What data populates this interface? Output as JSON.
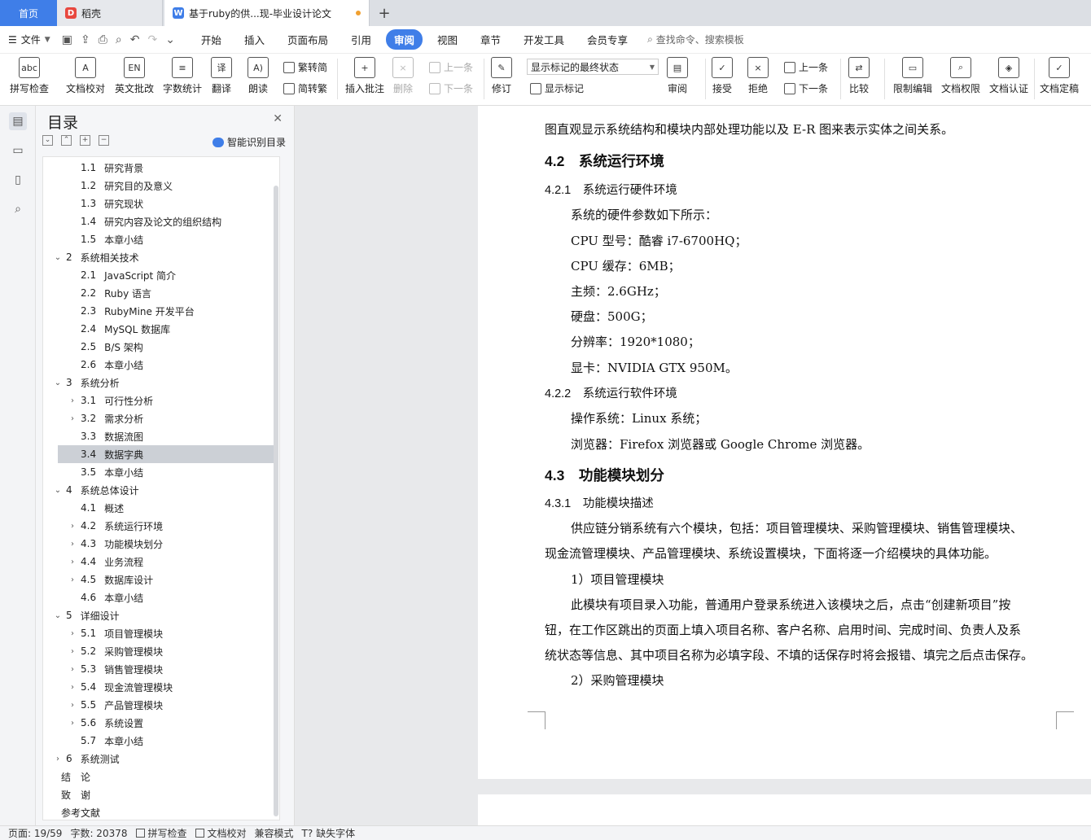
{
  "tabs": {
    "home": "首页",
    "daoke": "稻壳",
    "doc": "基于ruby的供...现-毕业设计论文",
    "add": "+"
  },
  "menubar": {
    "file": "文件",
    "items": [
      "开始",
      "插入",
      "页面布局",
      "引用",
      "审阅",
      "视图",
      "章节",
      "开发工具",
      "会员专享"
    ],
    "active": "审阅",
    "search_placeholder": "查找命令、搜索模板"
  },
  "ribbon": {
    "spell": "拼写检查",
    "doc_check": "文档校对",
    "en_correct": "英文批改",
    "word_count": "字数统计",
    "translate": "翻译",
    "read": "朗读",
    "to_trad": "繁转简",
    "to_simp": "简转繁",
    "insert_comment": "插入批注",
    "delete": "删除",
    "prev_comment": "上一条",
    "next_comment": "下一条",
    "track": "修订",
    "markup_state": "显示标记的最终状态",
    "show_markup": "显示标记",
    "review": "审阅",
    "accept": "接受",
    "reject": "拒绝",
    "prev": "上一条",
    "next": "下一条",
    "compare": "比较",
    "restrict": "限制编辑",
    "permission": "文档权限",
    "certify": "文档认证",
    "finalize": "文档定稿"
  },
  "toc": {
    "title": "目录",
    "smart": "智能识别目录",
    "items": [
      {
        "num": "1.1",
        "text": "研究背景",
        "level": 2,
        "arrow": ""
      },
      {
        "num": "1.2",
        "text": "研究目的及意义",
        "level": 2,
        "arrow": ""
      },
      {
        "num": "1.3",
        "text": "研究现状",
        "level": 2,
        "arrow": ""
      },
      {
        "num": "1.4",
        "text": "研究内容及论文的组织结构",
        "level": 2,
        "arrow": ""
      },
      {
        "num": "1.5",
        "text": "本章小结",
        "level": 2,
        "arrow": ""
      },
      {
        "num": "2",
        "text": "系统相关技术",
        "level": 1,
        "arrow": "v"
      },
      {
        "num": "2.1",
        "text": "JavaScript 简介",
        "level": 2,
        "arrow": ""
      },
      {
        "num": "2.2",
        "text": "Ruby 语言",
        "level": 2,
        "arrow": ""
      },
      {
        "num": "2.3",
        "text": "RubyMine 开发平台",
        "level": 2,
        "arrow": ""
      },
      {
        "num": "2.4",
        "text": "MySQL 数据库",
        "level": 2,
        "arrow": ""
      },
      {
        "num": "2.5",
        "text": "B/S 架构",
        "level": 2,
        "arrow": ""
      },
      {
        "num": "2.6",
        "text": "本章小结",
        "level": 2,
        "arrow": ""
      },
      {
        "num": "3",
        "text": "系统分析",
        "level": 1,
        "arrow": "v"
      },
      {
        "num": "3.1",
        "text": "可行性分析",
        "level": 2,
        "arrow": ">"
      },
      {
        "num": "3.2",
        "text": "需求分析",
        "level": 2,
        "arrow": ">"
      },
      {
        "num": "3.3",
        "text": "数据流图",
        "level": 2,
        "arrow": ""
      },
      {
        "num": "3.4",
        "text": "数据字典",
        "level": 2,
        "arrow": "",
        "selected": true
      },
      {
        "num": "3.5",
        "text": "本章小结",
        "level": 2,
        "arrow": ""
      },
      {
        "num": "4",
        "text": "系统总体设计",
        "level": 1,
        "arrow": "v"
      },
      {
        "num": "4.1",
        "text": "概述",
        "level": 2,
        "arrow": ""
      },
      {
        "num": "4.2",
        "text": "系统运行环境",
        "level": 2,
        "arrow": ">"
      },
      {
        "num": "4.3",
        "text": "功能模块划分",
        "level": 2,
        "arrow": ">"
      },
      {
        "num": "4.4",
        "text": "业务流程",
        "level": 2,
        "arrow": ">"
      },
      {
        "num": "4.5",
        "text": "数据库设计",
        "level": 2,
        "arrow": ">"
      },
      {
        "num": "4.6",
        "text": "本章小结",
        "level": 2,
        "arrow": ""
      },
      {
        "num": "5",
        "text": "详细设计",
        "level": 1,
        "arrow": "v"
      },
      {
        "num": "5.1",
        "text": "项目管理模块",
        "level": 2,
        "arrow": ">"
      },
      {
        "num": "5.2",
        "text": "采购管理模块",
        "level": 2,
        "arrow": ">"
      },
      {
        "num": "5.3",
        "text": "销售管理模块",
        "level": 2,
        "arrow": ">"
      },
      {
        "num": "5.4",
        "text": "现金流管理模块",
        "level": 2,
        "arrow": ">"
      },
      {
        "num": "5.5",
        "text": "产品管理模块",
        "level": 2,
        "arrow": ">"
      },
      {
        "num": "5.6",
        "text": "系统设置",
        "level": 2,
        "arrow": ">"
      },
      {
        "num": "5.7",
        "text": "本章小结",
        "level": 2,
        "arrow": ""
      },
      {
        "num": "6",
        "text": "系统测试",
        "level": 1,
        "arrow": ">"
      },
      {
        "num": "",
        "text": "结　论",
        "level": 0,
        "arrow": ""
      },
      {
        "num": "",
        "text": "致　谢",
        "level": 0,
        "arrow": ""
      },
      {
        "num": "",
        "text": "参考文献",
        "level": 0,
        "arrow": ""
      }
    ]
  },
  "document": {
    "lines": [
      {
        "text": "图直观显示系统结构和模块内部处理功能以及 E-R 图来表示实体之间关系。",
        "style": "p",
        "indent": 0
      },
      {
        "text": "4.2　系统运行环境",
        "style": "h2",
        "indent": 0
      },
      {
        "text": "4.2.1　系统运行硬件环境",
        "style": "h3",
        "indent": 0
      },
      {
        "text": "系统的硬件参数如下所示：",
        "style": "p",
        "indent": 1
      },
      {
        "text": "CPU 型号：酷睿 i7-6700HQ；",
        "style": "p",
        "indent": 1
      },
      {
        "text": "CPU 缓存：6MB；",
        "style": "p",
        "indent": 1
      },
      {
        "text": "主频：2.6GHz；",
        "style": "p",
        "indent": 1
      },
      {
        "text": "硬盘：500G；",
        "style": "p",
        "indent": 1
      },
      {
        "text": "分辨率：1920*1080；",
        "style": "p",
        "indent": 1
      },
      {
        "text": "显卡：NVIDIA GTX 950M。",
        "style": "p",
        "indent": 1
      },
      {
        "text": "4.2.2　系统运行软件环境",
        "style": "h3",
        "indent": 0
      },
      {
        "text": "操作系统：Linux 系统；",
        "style": "p",
        "indent": 1
      },
      {
        "text": "浏览器：Firefox 浏览器或 Google Chrome 浏览器。",
        "style": "p",
        "indent": 1
      },
      {
        "text": "4.3　功能模块划分",
        "style": "h2",
        "indent": 0
      },
      {
        "text": "4.3.1　功能模块描述",
        "style": "h3",
        "indent": 0
      },
      {
        "text": "供应链分销系统有六个模块，包括：项目管理模块、采购管理模块、销售管理模块、",
        "style": "p",
        "indent": 1
      },
      {
        "text": "现金流管理模块、产品管理模块、系统设置模块，下面将逐一介绍模块的具体功能。",
        "style": "p",
        "indent": 0
      },
      {
        "text": "1）项目管理模块",
        "style": "p",
        "indent": 1
      },
      {
        "text": "此模块有项目录入功能，普通用户登录系统进入该模块之后，点击“创建新项目”按",
        "style": "p",
        "indent": 1
      },
      {
        "text": "钮，在工作区跳出的页面上填入项目名称、客户名称、启用时间、完成时间、负责人及系",
        "style": "p",
        "indent": 0
      },
      {
        "text": "统状态等信息、其中项目名称为必填字段、不填的话保存时将会报错、填完之后点击保存。",
        "style": "p",
        "indent": 0
      },
      {
        "text": "2）采购管理模块",
        "style": "p",
        "indent": 1
      }
    ]
  },
  "status": {
    "page": "页面: 19/59",
    "words": "字数: 20378",
    "spell": "拼写检查",
    "doc_check": "文档校对",
    "compat": "兼容模式",
    "missing_font": "缺失字体"
  }
}
